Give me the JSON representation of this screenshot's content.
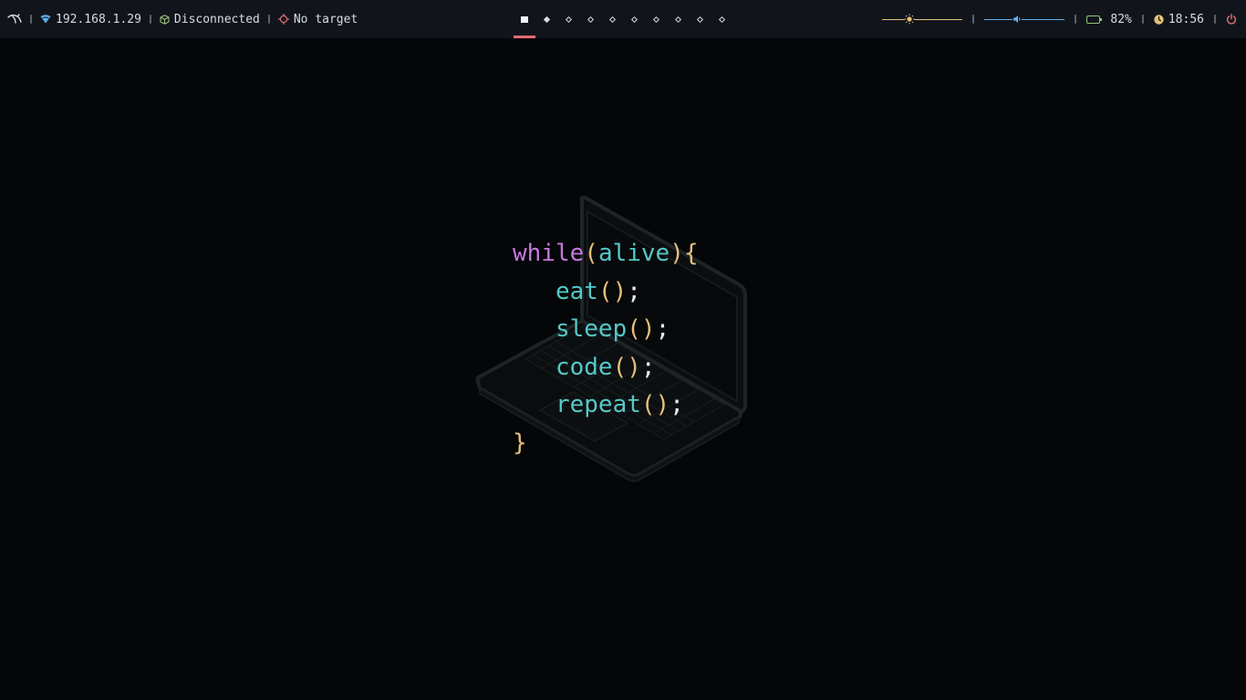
{
  "topbar": {
    "ip_address": "192.168.1.29",
    "vpn_status": "Disconnected",
    "target": "No target",
    "workspaces_count": 10,
    "active_workspace": 1,
    "brightness_level": 0.34,
    "volume_level": 0.41,
    "battery": "82%",
    "clock": "18:56",
    "icons": {
      "launcher": "kali-dragon-icon",
      "network": "wifi-icon",
      "vpn": "cube-icon",
      "target": "crosshair-icon",
      "brightness": "sun-icon",
      "volume": "speaker-icon",
      "battery": "battery-icon",
      "clock": "clock-icon",
      "power": "power-icon"
    },
    "colors": {
      "bar_bg": "#11151b",
      "workspace_active_underline": "#e06c75",
      "vpn_icon": "#98c379",
      "target_icon": "#e06c75",
      "brightness": "#e5c07b",
      "volume": "#61afef",
      "battery": "#98c379",
      "clock_icon": "#e5c07b",
      "power_icon": "#e06c75"
    }
  },
  "wallpaper": {
    "code": {
      "line1": {
        "keyword": "while",
        "open": "(",
        "arg": "alive",
        "close": ")",
        "brace": "{"
      },
      "line2": {
        "fn": "eat",
        "parens": "()",
        "semi": ";"
      },
      "line3": {
        "fn": "sleep",
        "parens": "()",
        "semi": ";"
      },
      "line4": {
        "fn": "code",
        "parens": "()",
        "semi": ";"
      },
      "line5": {
        "fn": "repeat",
        "parens": "()",
        "semi": ";"
      },
      "line6": {
        "brace": "}"
      }
    },
    "colors": {
      "keyword": "#c678dd",
      "function": "#56c8c8",
      "punctuation": "#e5c07b",
      "text": "#e8eaed",
      "background": "#040607"
    }
  }
}
